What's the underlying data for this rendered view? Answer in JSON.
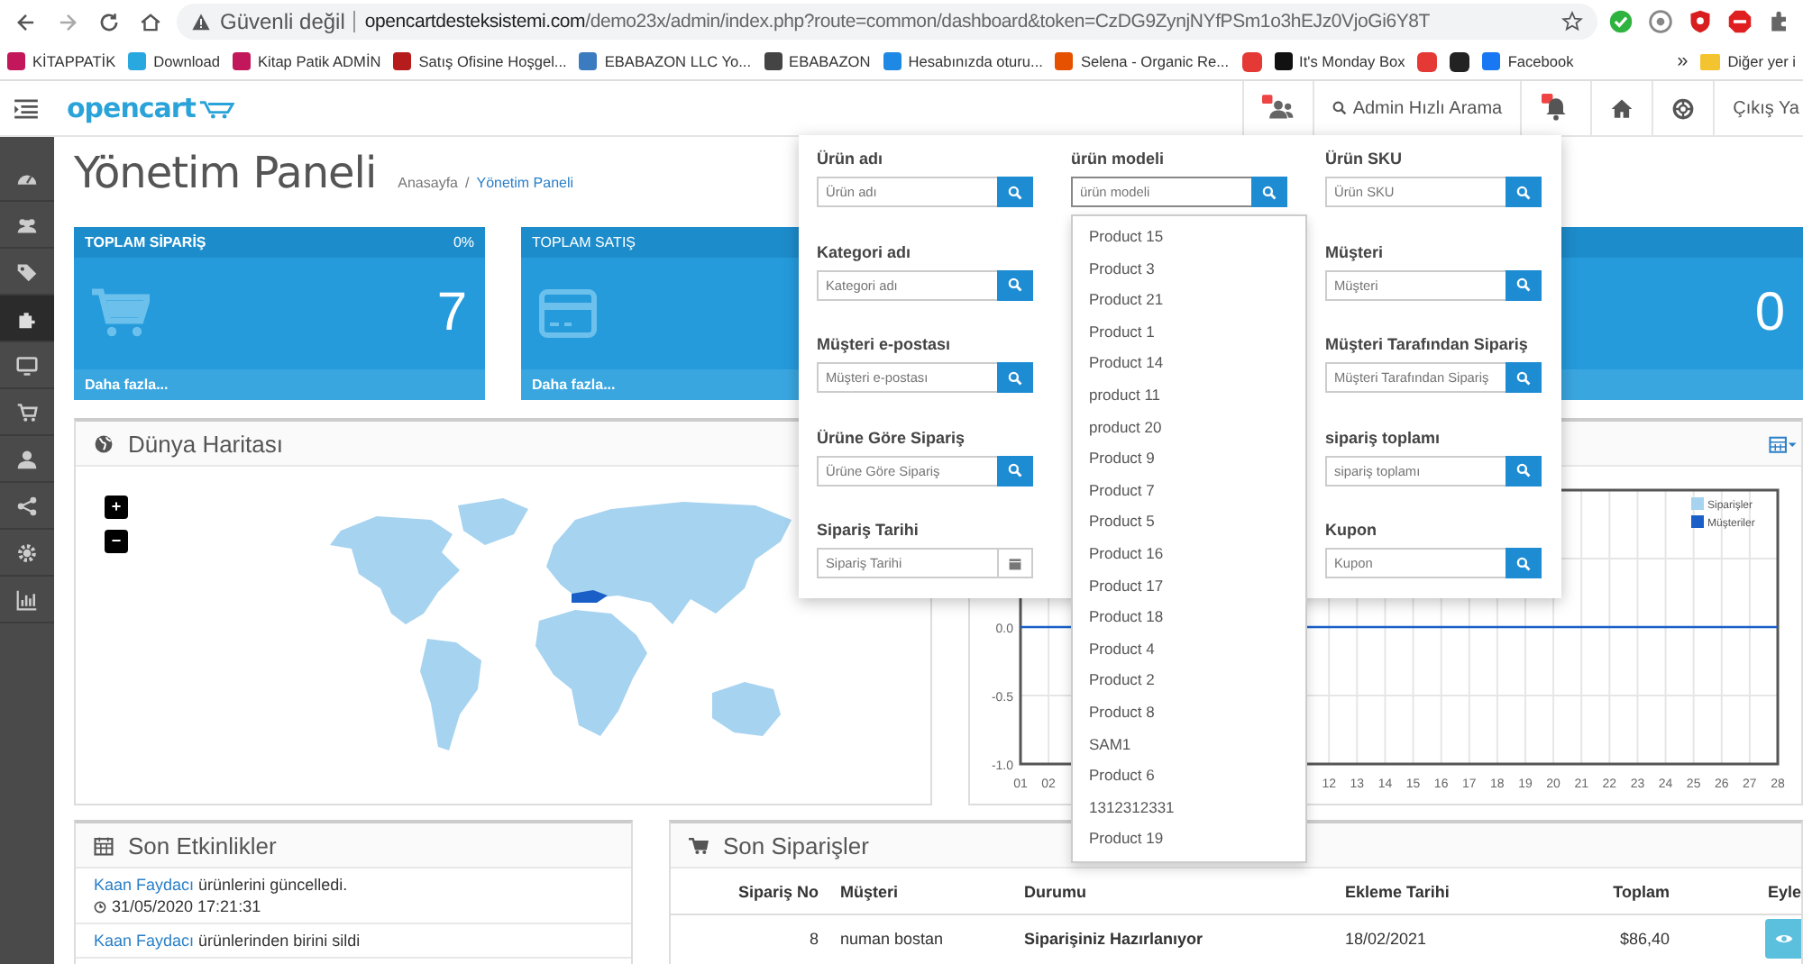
{
  "browser": {
    "security": "Güvenli değil",
    "url_host": "opencartdesteksistemi.com",
    "url_path": "/demo23x/admin/index.php?route=common/dashboard&token=CzDG9ZynjNYfPSm1o3hEJz0VjoGi6Y8T"
  },
  "bookmarks": [
    {
      "kind": "link",
      "label": "KİTAPPATİK"
    },
    {
      "kind": "link",
      "label": "Download"
    },
    {
      "kind": "link",
      "label": "Kitap Patik ADMİN"
    },
    {
      "kind": "link",
      "label": "Satış Ofisine Hoşgel..."
    },
    {
      "kind": "link",
      "label": "EBABAZON LLC Yo..."
    },
    {
      "kind": "link",
      "label": "EBABAZON"
    },
    {
      "kind": "link",
      "label": "Hesabınızda oturu..."
    },
    {
      "kind": "link",
      "label": "Selena - Organic Re..."
    },
    {
      "kind": "icon"
    },
    {
      "kind": "link",
      "label": "It's Monday Box"
    },
    {
      "kind": "icon"
    },
    {
      "kind": "icon"
    },
    {
      "kind": "link",
      "label": "Facebook"
    }
  ],
  "bookmarks_more": "»",
  "other_bookmarks": "Diğer yer i",
  "header": {
    "logo": "opencart",
    "search_link": "Admin Hızlı Arama",
    "logout": "Çıkış Ya"
  },
  "sidebar": {
    "items": [
      {
        "selected": false
      },
      {
        "selected": false
      },
      {
        "selected": false
      },
      {
        "selected": true
      },
      {
        "selected": false
      },
      {
        "selected": false
      },
      {
        "selected": false
      },
      {
        "selected": false
      },
      {
        "selected": false
      },
      {
        "selected": false
      }
    ]
  },
  "page": {
    "title": "Yönetim Paneli",
    "breadcrumbs": [
      "Anasayfa",
      "Yönetim Paneli"
    ],
    "breadcrumb_separator": "/"
  },
  "tiles": [
    {
      "kind": "cart",
      "title": "TOPLAM SİPARİŞ",
      "percent": "0%",
      "value": "7",
      "footer": "Daha fazla..."
    },
    {
      "kind": "card",
      "title": "TOPLAM SATIŞ",
      "footer": "Daha fazla..."
    },
    {
      "kind": "plain",
      "value": "0"
    }
  ],
  "map_panel": {
    "title": "Dünya Haritası",
    "controls": [
      "+",
      "−"
    ]
  },
  "chart_panel": {
    "chart_data": {
      "type": "line",
      "x": [
        1,
        2,
        3,
        4,
        5,
        6,
        7,
        8,
        9,
        10,
        11,
        12,
        13,
        14,
        15,
        16,
        17,
        18,
        19,
        20,
        21,
        22,
        23,
        24,
        25,
        26,
        27,
        28
      ],
      "series": [
        {
          "name": "Siparişler",
          "color": "#a6d3f0",
          "values": [
            null,
            null,
            null,
            null,
            null,
            null,
            null,
            null,
            null,
            null,
            null,
            null,
            null,
            null,
            null,
            null,
            null,
            null,
            null,
            null,
            null,
            null,
            null,
            null,
            null,
            null,
            null,
            null
          ]
        },
        {
          "name": "Müşteriler",
          "color": "#1a5fc8",
          "values": [
            0,
            0,
            0,
            null,
            null,
            null,
            null,
            null,
            null,
            null,
            0,
            0,
            0,
            0,
            0,
            0,
            0,
            0,
            0,
            0,
            0,
            0,
            0,
            0,
            0,
            0,
            0,
            0
          ]
        }
      ],
      "xlim": [
        1,
        28
      ],
      "ylim": [
        -1,
        1
      ],
      "grid": true,
      "legend": "upper right",
      "yticks": [
        {
          "value": 0,
          "label": "0.0"
        },
        {
          "value": -0.5,
          "label": "-0.5"
        },
        {
          "value": -1,
          "label": "-1.0"
        }
      ],
      "xticks": [
        {
          "value": 1,
          "label": "01"
        },
        {
          "value": 2,
          "label": "02"
        },
        {
          "value": 12,
          "label": "12"
        },
        {
          "value": 13,
          "label": "13"
        },
        {
          "value": 14,
          "label": "14"
        },
        {
          "value": 15,
          "label": "15"
        },
        {
          "value": 16,
          "label": "16"
        },
        {
          "value": 17,
          "label": "17"
        },
        {
          "value": 18,
          "label": "18"
        },
        {
          "value": 19,
          "label": "19"
        },
        {
          "value": 20,
          "label": "20"
        },
        {
          "value": 21,
          "label": "21"
        },
        {
          "value": 22,
          "label": "22"
        },
        {
          "value": 23,
          "label": "23"
        },
        {
          "value": 24,
          "label": "24"
        },
        {
          "value": 25,
          "label": "25"
        },
        {
          "value": 26,
          "label": "26"
        },
        {
          "value": 27,
          "label": "27"
        },
        {
          "value": 28,
          "label": "28"
        }
      ]
    }
  },
  "activity_panel": {
    "title": "Son Etkinlikler",
    "items": [
      {
        "user": "Kaan Faydacı",
        "text": "ürünlerini güncelledi.",
        "time": "31/05/2020 17:21:31"
      },
      {
        "user": "Kaan Faydacı",
        "text": "ürünlerinden birini sildi"
      }
    ]
  },
  "orders_panel": {
    "title": "Son Siparişler",
    "columns": [
      "Sipariş No",
      "Müşteri",
      "Durumu",
      "Ekleme Tarihi",
      "Toplam",
      "Eyle"
    ],
    "rows": [
      {
        "cells": [
          "8",
          "numan bostan",
          "Siparişiniz Hazırlanıyor",
          "18/02/2021",
          "$86,40"
        ]
      }
    ]
  },
  "search_popover": {
    "columns": [
      [
        {
          "kind": "search",
          "label": "Ürün adı",
          "placeholder": "Ürün adı",
          "focused": false
        },
        {
          "kind": "search",
          "label": "Kategori adı",
          "placeholder": "Kategori adı",
          "focused": false
        },
        {
          "kind": "search",
          "label": "Müşteri e-postası",
          "placeholder": "Müşteri e-postası",
          "focused": false
        },
        {
          "kind": "search",
          "label": "Ürüne Göre Sipariş",
          "placeholder": "Ürüne Göre Sipariş",
          "focused": false
        },
        {
          "kind": "date",
          "label": "Sipariş Tarihi",
          "placeholder": "Sipariş Tarihi",
          "focused": false
        }
      ],
      [
        {
          "kind": "search",
          "label": "ürün modeli",
          "placeholder": "ürün modeli",
          "focused": true
        }
      ],
      [
        {
          "kind": "search",
          "label": "Ürün SKU",
          "placeholder": "Ürün SKU",
          "focused": false
        },
        {
          "kind": "search",
          "label": "Müşteri",
          "placeholder": "Müşteri",
          "focused": false
        },
        {
          "kind": "search",
          "label": "Müşteri Tarafından Sipariş",
          "placeholder": "Müşteri Tarafından Sipariş",
          "focused": false
        },
        {
          "kind": "search",
          "label": "sipariş toplamı",
          "placeholder": "sipariş toplamı",
          "focused": false
        },
        {
          "kind": "search",
          "label": "Kupon",
          "placeholder": "Kupon",
          "focused": false
        }
      ]
    ],
    "suggestions": [
      "Product 15",
      "Product 3",
      "Product 21",
      "Product 1",
      "Product 14",
      "product 11",
      "product 20",
      "Product 9",
      "Product 7",
      "Product 5",
      "Product 16",
      "Product 17",
      "Product 18",
      "Product 4",
      "Product 2",
      "Product 8",
      "SAM1",
      "Product 6",
      "1312312331",
      "Product 19"
    ]
  }
}
